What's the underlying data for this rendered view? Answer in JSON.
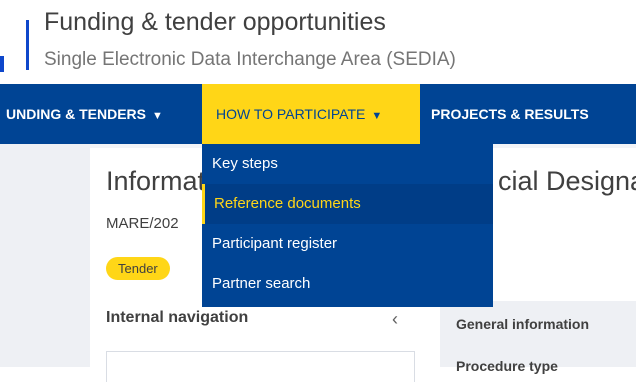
{
  "header": {
    "title": "Funding & tender opportunities",
    "subtitle": "Single Electronic Data Interchange Area (SEDIA)"
  },
  "nav": {
    "items": [
      {
        "label": "UNDING & TENDERS",
        "caret": "▼"
      },
      {
        "label": "HOW TO PARTICIPATE",
        "caret": "▼"
      },
      {
        "label": "PROJECTS & RESULTS"
      }
    ]
  },
  "dropdown": {
    "items": [
      {
        "label": "Key steps"
      },
      {
        "label": "Reference documents"
      },
      {
        "label": "Participant register"
      },
      {
        "label": "Partner search"
      }
    ]
  },
  "page": {
    "title_visible_start": "Informat",
    "title_visible_end": "cial Designa",
    "reference": "MARE/202",
    "badge": "Tender",
    "internal_nav": "Internal navigation",
    "collapse_glyph": "‹",
    "general_info": "General information",
    "procedure_type": "Procedure type"
  },
  "colors": {
    "primary": "#004494",
    "accent": "#ffd617"
  }
}
